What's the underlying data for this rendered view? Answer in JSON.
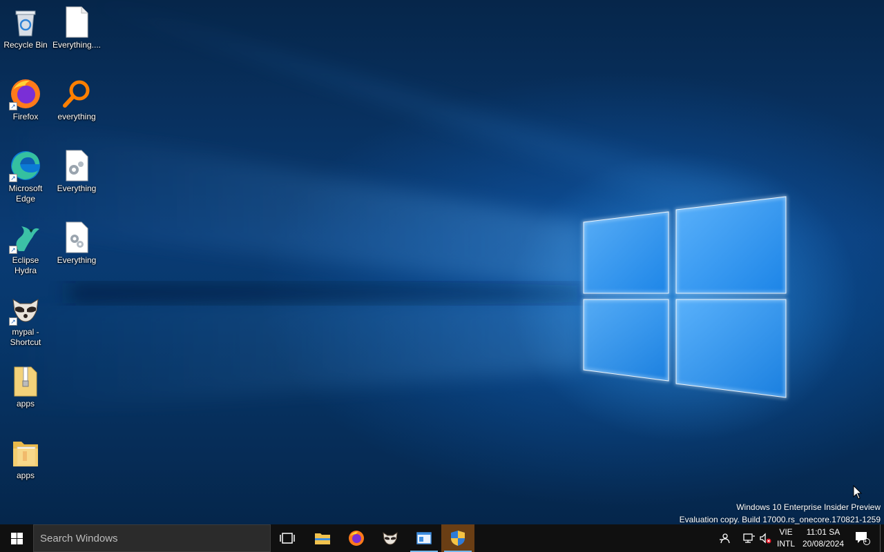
{
  "desktop": {
    "icons": [
      {
        "label": "Recycle Bin",
        "icon": "recycle-bin-icon"
      },
      {
        "label": "Everything....",
        "icon": "blank-document-icon"
      },
      {
        "label": "Firefox",
        "icon": "firefox-icon"
      },
      {
        "label": "everything",
        "icon": "magnifier-icon"
      },
      {
        "label": "Microsoft Edge",
        "icon": "edge-icon"
      },
      {
        "label": "Everything",
        "icon": "settings-document-icon"
      },
      {
        "label": "Eclipse Hydra",
        "icon": "hydra-icon"
      },
      {
        "label": "Everything",
        "icon": "settings-document-icon"
      },
      {
        "label": "mypal - Shortcut",
        "icon": "raccoon-icon"
      },
      {
        "label": "apps",
        "icon": "zip-folder-icon"
      },
      {
        "label": "apps",
        "icon": "folder-icon"
      }
    ],
    "watermark": {
      "line1": "Windows 10 Enterprise Insider Preview",
      "line2": "Evaluation copy. Build 17000.rs_onecore.170821-1259"
    }
  },
  "taskbar": {
    "search_placeholder": "Search Windows",
    "apps": [
      {
        "name": "Task View",
        "icon": "task-view-icon"
      },
      {
        "name": "File Explorer",
        "icon": "folder-icon"
      },
      {
        "name": "Firefox",
        "icon": "firefox-icon"
      },
      {
        "name": "mypal",
        "icon": "raccoon-icon"
      },
      {
        "name": "Window app",
        "icon": "window-icon"
      },
      {
        "name": "User Account Control",
        "icon": "uac-shield-icon"
      }
    ],
    "tray": {
      "language_top": "VIE",
      "language_bottom": "INTL",
      "time": "11:01 SA",
      "date": "20/08/2024",
      "notification_count": "4"
    }
  },
  "colors": {
    "taskbar": "#101010",
    "active_app": "#6a3e14",
    "accent": "#76b9ed"
  }
}
